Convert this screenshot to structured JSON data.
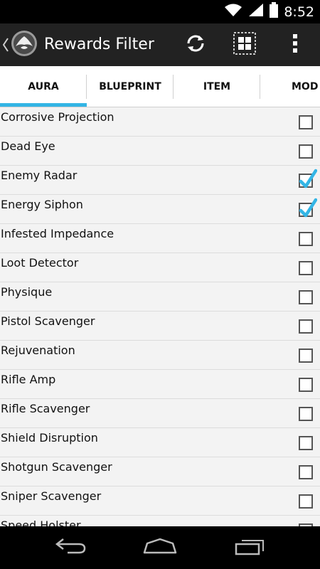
{
  "status_bar": {
    "time": "8:52",
    "icons": [
      "wifi-icon",
      "signal-icon",
      "battery-icon"
    ]
  },
  "action_bar": {
    "title": "Rewards Filter",
    "icons": [
      "up-arrow-icon",
      "app-logo-icon",
      "refresh-icon",
      "select-all-icon",
      "overflow-menu-icon"
    ]
  },
  "tabs": [
    {
      "label": "AURA",
      "selected": true
    },
    {
      "label": "BLUEPRINT",
      "selected": false
    },
    {
      "label": "ITEM",
      "selected": false
    },
    {
      "label": "MOD",
      "selected": false
    }
  ],
  "items": [
    {
      "label": "Corrosive Projection",
      "checked": false
    },
    {
      "label": "Dead Eye",
      "checked": false
    },
    {
      "label": "Enemy Radar",
      "checked": true
    },
    {
      "label": "Energy Siphon",
      "checked": true
    },
    {
      "label": "Infested Impedance",
      "checked": false
    },
    {
      "label": "Loot Detector",
      "checked": false
    },
    {
      "label": "Physique",
      "checked": false
    },
    {
      "label": "Pistol Scavenger",
      "checked": false
    },
    {
      "label": "Rejuvenation",
      "checked": false
    },
    {
      "label": "Rifle Amp",
      "checked": false
    },
    {
      "label": "Rifle Scavenger",
      "checked": false
    },
    {
      "label": "Shield Disruption",
      "checked": false
    },
    {
      "label": "Shotgun Scavenger",
      "checked": false
    },
    {
      "label": "Sniper Scavenger",
      "checked": false
    },
    {
      "label": "Speed Holster",
      "checked": false
    }
  ],
  "nav_bar": {
    "icons": [
      "back-icon",
      "home-icon",
      "recent-apps-icon"
    ]
  },
  "colors": {
    "accent": "#33b5e5",
    "action_bar": "#222222",
    "list_bg": "#f3f3f3"
  }
}
